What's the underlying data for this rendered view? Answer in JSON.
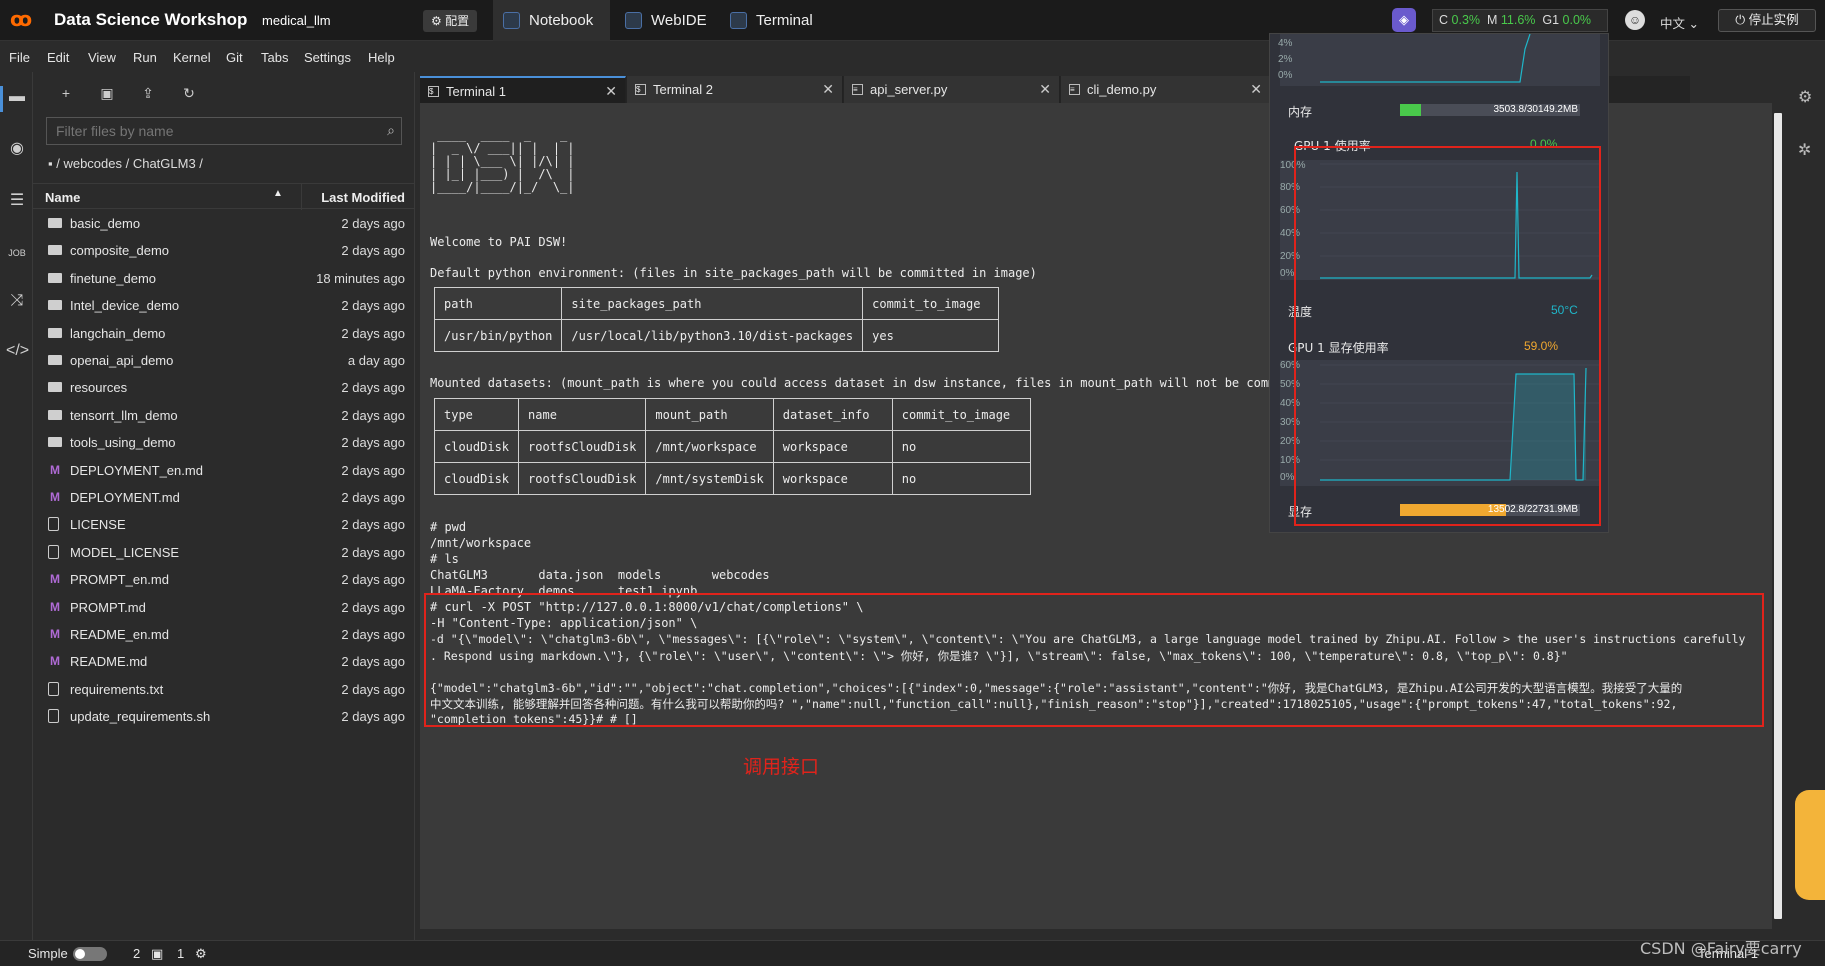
{
  "app": {
    "title": "Data Science Workshop",
    "instance_name": "medical_llm",
    "config_label": "配置",
    "tabs": [
      "Notebook",
      "WebIDE",
      "Terminal"
    ],
    "resources": {
      "c_label": "C",
      "c_val": "0.3%",
      "m_label": "M",
      "m_val": "11.6%",
      "g_label": "G1",
      "g_val": "0.0%"
    },
    "language": "中文",
    "stop_label": "停止实例"
  },
  "menu": [
    "File",
    "Edit",
    "View",
    "Run",
    "Kernel",
    "Git",
    "Tabs",
    "Settings",
    "Help"
  ],
  "filebrowser": {
    "filter_placeholder": "Filter files by name",
    "breadcrumb": "/ webcodes / ChatGLM3 /",
    "col_name": "Name",
    "col_modified": "Last Modified",
    "files": [
      {
        "name": "basic_demo",
        "type": "folder",
        "modified": "2 days ago"
      },
      {
        "name": "composite_demo",
        "type": "folder",
        "modified": "2 days ago"
      },
      {
        "name": "finetune_demo",
        "type": "folder",
        "modified": "18 minutes ago"
      },
      {
        "name": "Intel_device_demo",
        "type": "folder",
        "modified": "2 days ago"
      },
      {
        "name": "langchain_demo",
        "type": "folder",
        "modified": "2 days ago"
      },
      {
        "name": "openai_api_demo",
        "type": "folder",
        "modified": "a day ago"
      },
      {
        "name": "resources",
        "type": "folder",
        "modified": "2 days ago"
      },
      {
        "name": "tensorrt_llm_demo",
        "type": "folder",
        "modified": "2 days ago"
      },
      {
        "name": "tools_using_demo",
        "type": "folder",
        "modified": "2 days ago"
      },
      {
        "name": "DEPLOYMENT_en.md",
        "type": "md",
        "modified": "2 days ago"
      },
      {
        "name": "DEPLOYMENT.md",
        "type": "md",
        "modified": "2 days ago"
      },
      {
        "name": "LICENSE",
        "type": "doc",
        "modified": "2 days ago"
      },
      {
        "name": "MODEL_LICENSE",
        "type": "doc",
        "modified": "2 days ago"
      },
      {
        "name": "PROMPT_en.md",
        "type": "md",
        "modified": "2 days ago"
      },
      {
        "name": "PROMPT.md",
        "type": "md",
        "modified": "2 days ago"
      },
      {
        "name": "README_en.md",
        "type": "md",
        "modified": "2 days ago"
      },
      {
        "name": "README.md",
        "type": "md",
        "modified": "2 days ago"
      },
      {
        "name": "requirements.txt",
        "type": "doc",
        "modified": "2 days ago"
      },
      {
        "name": "update_requirements.sh",
        "type": "doc",
        "modified": "2 days ago"
      }
    ]
  },
  "doc_tabs": [
    "Terminal 1",
    "Terminal 2",
    "api_server.py",
    "cli_demo.py"
  ],
  "terminal": {
    "ascii_art": " ____  ____  _    _\n|  _ \\/ ___|| |  | |\n| | | \\___ \\| |/\\| |\n| |_| |___) |  /\\  |\n|____/|____/|_/  \\_|",
    "welcome": "Welcome to PAI DSW!",
    "env_line": "Default python environment: (files in site_packages_path will be committed in image)",
    "env_table": {
      "headers": [
        "path",
        "site_packages_path",
        "commit_to_image"
      ],
      "rows": [
        [
          "/usr/bin/python",
          "/usr/local/lib/python3.10/dist-packages",
          "yes"
        ]
      ]
    },
    "mounted_line": "Mounted datasets: (mount_path is where you could access dataset in dsw instance, files in mount_path will not be committ",
    "mount_table": {
      "headers": [
        "type",
        "name",
        "mount_path",
        "dataset_info",
        "commit_to_image"
      ],
      "rows": [
        [
          "cloudDisk",
          "rootfsCloudDisk",
          "/mnt/workspace",
          "workspace",
          "no"
        ],
        [
          "cloudDisk",
          "rootfsCloudDisk",
          "/mnt/systemDisk",
          "workspace",
          "no"
        ]
      ]
    },
    "lines": [
      "# pwd",
      "/mnt/workspace",
      "# ls",
      "ChatGLM3       data.json  models       webcodes",
      "LLaMA-Factory  demos      test1.ipynb",
      "# curl -X POST \"http://127.0.0.1:8000/v1/chat/completions\" \\",
      "-H \"Content-Type: application/json\" \\",
      "-d \"{\\\"model\\\": \\\"chatglm3-6b\\\", \\\"messages\\\": [{\\\"role\\\": \\\"system\\\", \\\"content\\\": \\\"You are ChatGLM3, a large language model trained by Zhipu.AI. Follow > the user's instructions carefully",
      ". Respond using markdown.\\\"}, {\\\"role\\\": \\\"user\\\", \\\"content\\\": \\\"> 你好, 你是谁? \\\"}], \\\"stream\\\": false, \\\"max_tokens\\\": 100, \\\"temperature\\\": 0.8, \\\"top_p\\\": 0.8}\"",
      "{\"model\":\"chatglm3-6b\",\"id\":\"\",\"object\":\"chat.completion\",\"choices\":[{\"index\":0,\"message\":{\"role\":\"assistant\",\"content\":\"你好, 我是ChatGLM3, 是Zhipu.AI公司开发的大型语言模型。我接受了大量的",
      "中文文本训练, 能够理解并回答各种问题。有什么我可以帮助你的吗? \",\"name\":null,\"function_call\":null},\"finish_reason\":\"stop\"}],\"created\":1718025105,\"usage\":{\"prompt_tokens\":47,\"total_tokens\":92,",
      "\"completion_tokens\":45}}# # []"
    ],
    "annotation": "调用接口"
  },
  "monitor": {
    "cpu_ticks": [
      "4%",
      "2%",
      "0%"
    ],
    "mem_label": "内存",
    "mem_text": "3503.8/30149.2MB",
    "mem_fraction": 0.116,
    "gpu_util_label": "GPU 1 使用率",
    "gpu_util_val": "0.0%",
    "gpu_util_ticks": [
      "100%",
      "80%",
      "60%",
      "40%",
      "20%",
      "0%"
    ],
    "temp_label": "温度",
    "temp_val": "50°C",
    "gpu_mem_label": "GPU 1 显存使用率",
    "gpu_mem_val": "59.0%",
    "gpu_mem_ticks": [
      "60%",
      "50%",
      "40%",
      "30%",
      "20%",
      "10%",
      "0%"
    ],
    "vram_label": "显存",
    "vram_text": "13502.8/22731.9MB",
    "vram_fraction": 0.59,
    "colors": {
      "line": "#1fb6c9",
      "mem_fill": "#49c94b",
      "vram_fill": "#f0a830",
      "temp": "#1fb6c9",
      "gpu_val": "#49c94b",
      "gpu_mem_val": "#f0a830"
    }
  },
  "status": {
    "simple_label": "Simple",
    "count1": "2",
    "count2": "1",
    "right_label": "Terminal 1"
  },
  "watermark": "CSDN @Fairy要carry"
}
